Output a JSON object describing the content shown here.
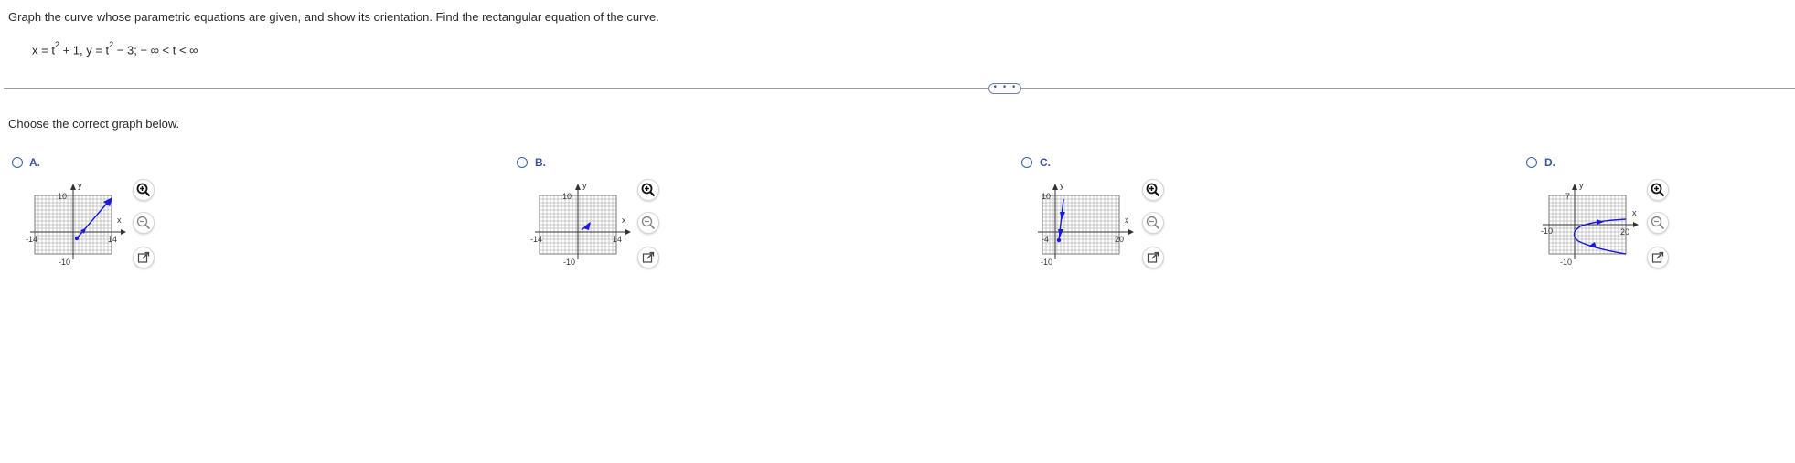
{
  "question": {
    "text": "Graph the curve whose parametric equations are given, and show its orientation. Find the rectangular equation of the curve.",
    "eq_x_lhs": "x = t",
    "eq_x_exp": "2",
    "eq_x_rhs": " + 1,  y = t",
    "eq_y_exp": "2",
    "eq_y_rhs": " − 3;   − ∞ < t < ∞"
  },
  "more_button": {
    "label": "• • •"
  },
  "prompt": "Choose the correct graph below.",
  "options": [
    {
      "letter": "A.",
      "axis_labels": {
        "x": "x",
        "y": "y"
      },
      "ticks": {
        "x_min": "-14",
        "x_max": "14",
        "y_max": "10",
        "y_min": "-10"
      },
      "curve": {
        "type": "ray",
        "from": [
          1,
          -3
        ],
        "to": [
          14,
          10
        ],
        "orientation": "outward"
      },
      "icons": [
        "zoom-in-icon",
        "zoom-out-icon",
        "external-link-icon"
      ]
    },
    {
      "letter": "B.",
      "axis_labels": {
        "x": "x",
        "y": "y"
      },
      "ticks": {
        "x_min": "-14",
        "x_max": "14",
        "y_max": "10",
        "y_min": "-10"
      },
      "curve": {
        "type": "segment-arrow",
        "orientation": "toward-origin"
      },
      "icons": [
        "zoom-in-icon",
        "zoom-out-icon",
        "external-link-icon"
      ]
    },
    {
      "letter": "C.",
      "axis_labels": {
        "x": "x",
        "y": "y"
      },
      "ticks": {
        "x_min": "-4",
        "x_max": "20",
        "y_max": "10",
        "y_min": "-10"
      },
      "curve": {
        "type": "ray",
        "orientation": "downward"
      },
      "icons": [
        "zoom-in-icon",
        "zoom-out-icon",
        "external-link-icon"
      ]
    },
    {
      "letter": "D.",
      "axis_labels": {
        "x": "x",
        "y": "y"
      },
      "ticks": {
        "x_min": "-10",
        "x_max": "20",
        "y_max": "7",
        "y_min": "-10"
      },
      "curve": {
        "type": "parabola",
        "orientation": "both-branches"
      },
      "icons": [
        "zoom-in-icon",
        "zoom-out-icon",
        "external-link-icon"
      ]
    }
  ],
  "colors": {
    "curve": "#1a1ad6",
    "grid": "#9a9a9a",
    "radio": "#3a5fa8",
    "label": "#3a52a0"
  }
}
